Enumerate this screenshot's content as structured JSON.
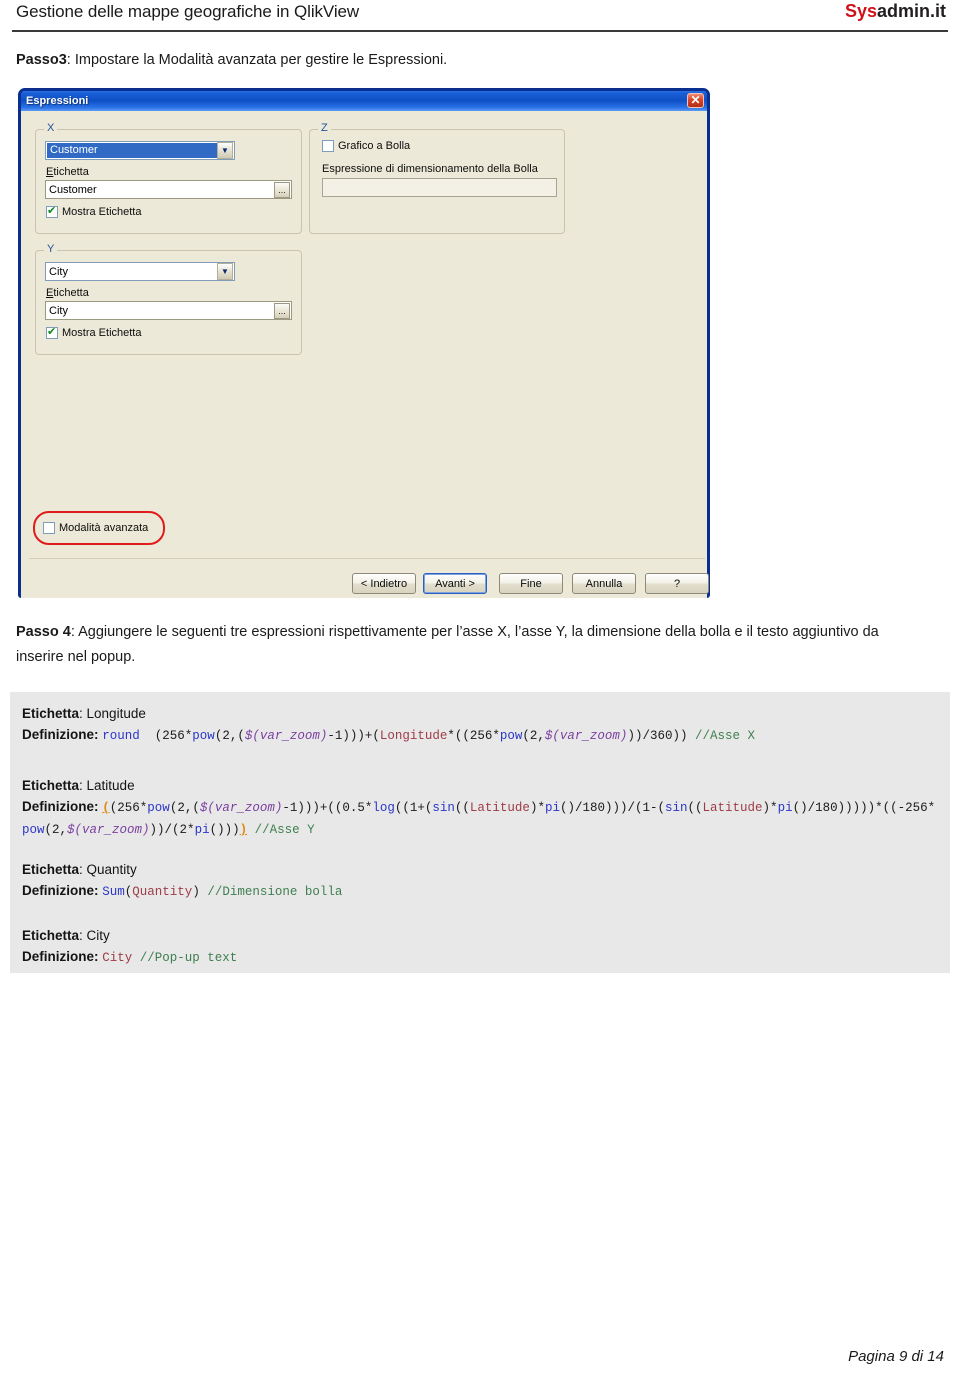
{
  "header": {
    "title": "Gestione delle mappe geografiche in QlikView",
    "brand_red": "Sys",
    "brand_dark": "admin.it"
  },
  "passo3": {
    "label": "Passo3",
    "text": ": Impostare la Modalità avanzata per gestire le Espressioni."
  },
  "dialog": {
    "title": "Espressioni",
    "close_icon": "✕",
    "groups": {
      "x": {
        "legend": "X",
        "combo_value": "Customer",
        "combo_arrow_icon": "▼",
        "label_caption": "Etichetta",
        "label_caption_underline": "E",
        "textbox_value": "Customer",
        "ellipsis_icon": "...",
        "checkbox_label": "Mostra Etichetta",
        "checkbox_checked": true
      },
      "y": {
        "legend": "Y",
        "combo_value": "City",
        "combo_arrow_icon": "▼",
        "label_caption": "Etichetta",
        "textbox_value": "City",
        "ellipsis_icon": "...",
        "checkbox_label": "Mostra Etichetta",
        "checkbox_checked": true
      },
      "z": {
        "legend": "Z",
        "checkbox_label": "Grafico a Bolla",
        "checkbox_checked": false,
        "expr_caption": "Espressione di dimensionamento della Bolla",
        "expr_value": ""
      }
    },
    "advanced_mode": {
      "label": "Modalità avanzata",
      "checked": false,
      "highlight_color": "#e01b1b"
    },
    "buttons": [
      {
        "id": "back",
        "label": "< Indietro",
        "default": false
      },
      {
        "id": "next",
        "label": "Avanti >",
        "default": true
      },
      {
        "id": "finish",
        "label": "Fine",
        "default": false
      },
      {
        "id": "cancel",
        "label": "Annulla",
        "default": false
      },
      {
        "id": "help",
        "label": "?",
        "default": false
      }
    ]
  },
  "passo4": {
    "label": "Passo 4",
    "text": ": Aggiungere le seguenti tre espressioni rispettivamente per l’asse X, l’asse Y, la dimensione della bolla e il testo aggiuntivo da inserire nel popup."
  },
  "code": {
    "label_prefix": "Etichetta",
    "def_prefix": "Definizione",
    "entries": [
      {
        "label": "Longitude",
        "definition_plain": "round (256*pow(2,($(var_zoom)-1)))+(Longitude*((256*pow(2,$(var_zoom)))/360)) //Asse X",
        "tokens": [
          {
            "t": "round ",
            "c": "k-fn"
          },
          {
            "t": " (256*",
            "c": "k-plain"
          },
          {
            "t": "pow",
            "c": "k-fn"
          },
          {
            "t": "(2,(",
            "c": "k-plain"
          },
          {
            "t": "$(var_zoom)",
            "c": "k-var"
          },
          {
            "t": "-1)))+(",
            "c": "k-plain"
          },
          {
            "t": "Longitude",
            "c": "k-field"
          },
          {
            "t": "*((256*",
            "c": "k-plain"
          },
          {
            "t": "pow",
            "c": "k-fn"
          },
          {
            "t": "(2,",
            "c": "k-plain"
          },
          {
            "t": "$(var_zoom)",
            "c": "k-var"
          },
          {
            "t": "))/360)) ",
            "c": "k-plain"
          },
          {
            "t": "//Asse X",
            "c": "k-cmt"
          }
        ]
      },
      {
        "label": "Latitude",
        "definition_plain": "((256*pow(2,($(var_zoom)-1)))+((0.5*log((1+(sin((Latitude)*pi()/180)))/(1-(sin((Latitude)*pi()/180)))))*((-256*pow(2,$(var_zoom)))/(2*pi())))) //Asse Y",
        "tokens": [
          {
            "t": "(",
            "c": "k-match"
          },
          {
            "t": "(256*",
            "c": "k-plain"
          },
          {
            "t": "pow",
            "c": "k-fn"
          },
          {
            "t": "(2,(",
            "c": "k-plain"
          },
          {
            "t": "$(var_zoom)",
            "c": "k-var"
          },
          {
            "t": "-1)))+((0.5*",
            "c": "k-plain"
          },
          {
            "t": "log",
            "c": "k-fn"
          },
          {
            "t": "((1+(",
            "c": "k-plain"
          },
          {
            "t": "sin",
            "c": "k-fn"
          },
          {
            "t": "((",
            "c": "k-plain"
          },
          {
            "t": "Latitude",
            "c": "k-field"
          },
          {
            "t": ")*",
            "c": "k-plain"
          },
          {
            "t": "pi",
            "c": "k-fn"
          },
          {
            "t": "()/180)))/(1-(",
            "c": "k-plain"
          },
          {
            "t": "sin",
            "c": "k-fn"
          },
          {
            "t": "((",
            "c": "k-plain"
          },
          {
            "t": "Latitude",
            "c": "k-field"
          },
          {
            "t": ")*",
            "c": "k-plain"
          },
          {
            "t": "pi",
            "c": "k-fn"
          },
          {
            "t": "()/180)))))*((-256*",
            "c": "k-plain"
          },
          {
            "t": "pow",
            "c": "k-fn"
          },
          {
            "t": "(2,",
            "c": "k-plain"
          },
          {
            "t": "$(var_zoom)",
            "c": "k-var"
          },
          {
            "t": "))/(2*",
            "c": "k-plain"
          },
          {
            "t": "pi",
            "c": "k-fn"
          },
          {
            "t": "()))",
            "c": "k-plain"
          },
          {
            "t": ")",
            "c": "k-match"
          },
          {
            "t": " ",
            "c": "k-plain"
          },
          {
            "t": "//Asse Y",
            "c": "k-cmt"
          }
        ]
      },
      {
        "label": "Quantity",
        "definition_plain": "Sum(Quantity) //Dimensione bolla",
        "tokens": [
          {
            "t": "Sum",
            "c": "k-fn"
          },
          {
            "t": "(",
            "c": "k-plain"
          },
          {
            "t": "Quantity",
            "c": "k-field"
          },
          {
            "t": ") ",
            "c": "k-plain"
          },
          {
            "t": "//Dimensione bolla",
            "c": "k-cmt"
          }
        ]
      },
      {
        "label": "City",
        "definition_plain": "City //Pop-up text",
        "tokens": [
          {
            "t": "City",
            "c": "k-field"
          },
          {
            "t": " ",
            "c": "k-plain"
          },
          {
            "t": "//Pop-up text",
            "c": "k-cmt"
          }
        ]
      }
    ]
  },
  "footer": {
    "page_text": "Pagina 9 di 14"
  }
}
